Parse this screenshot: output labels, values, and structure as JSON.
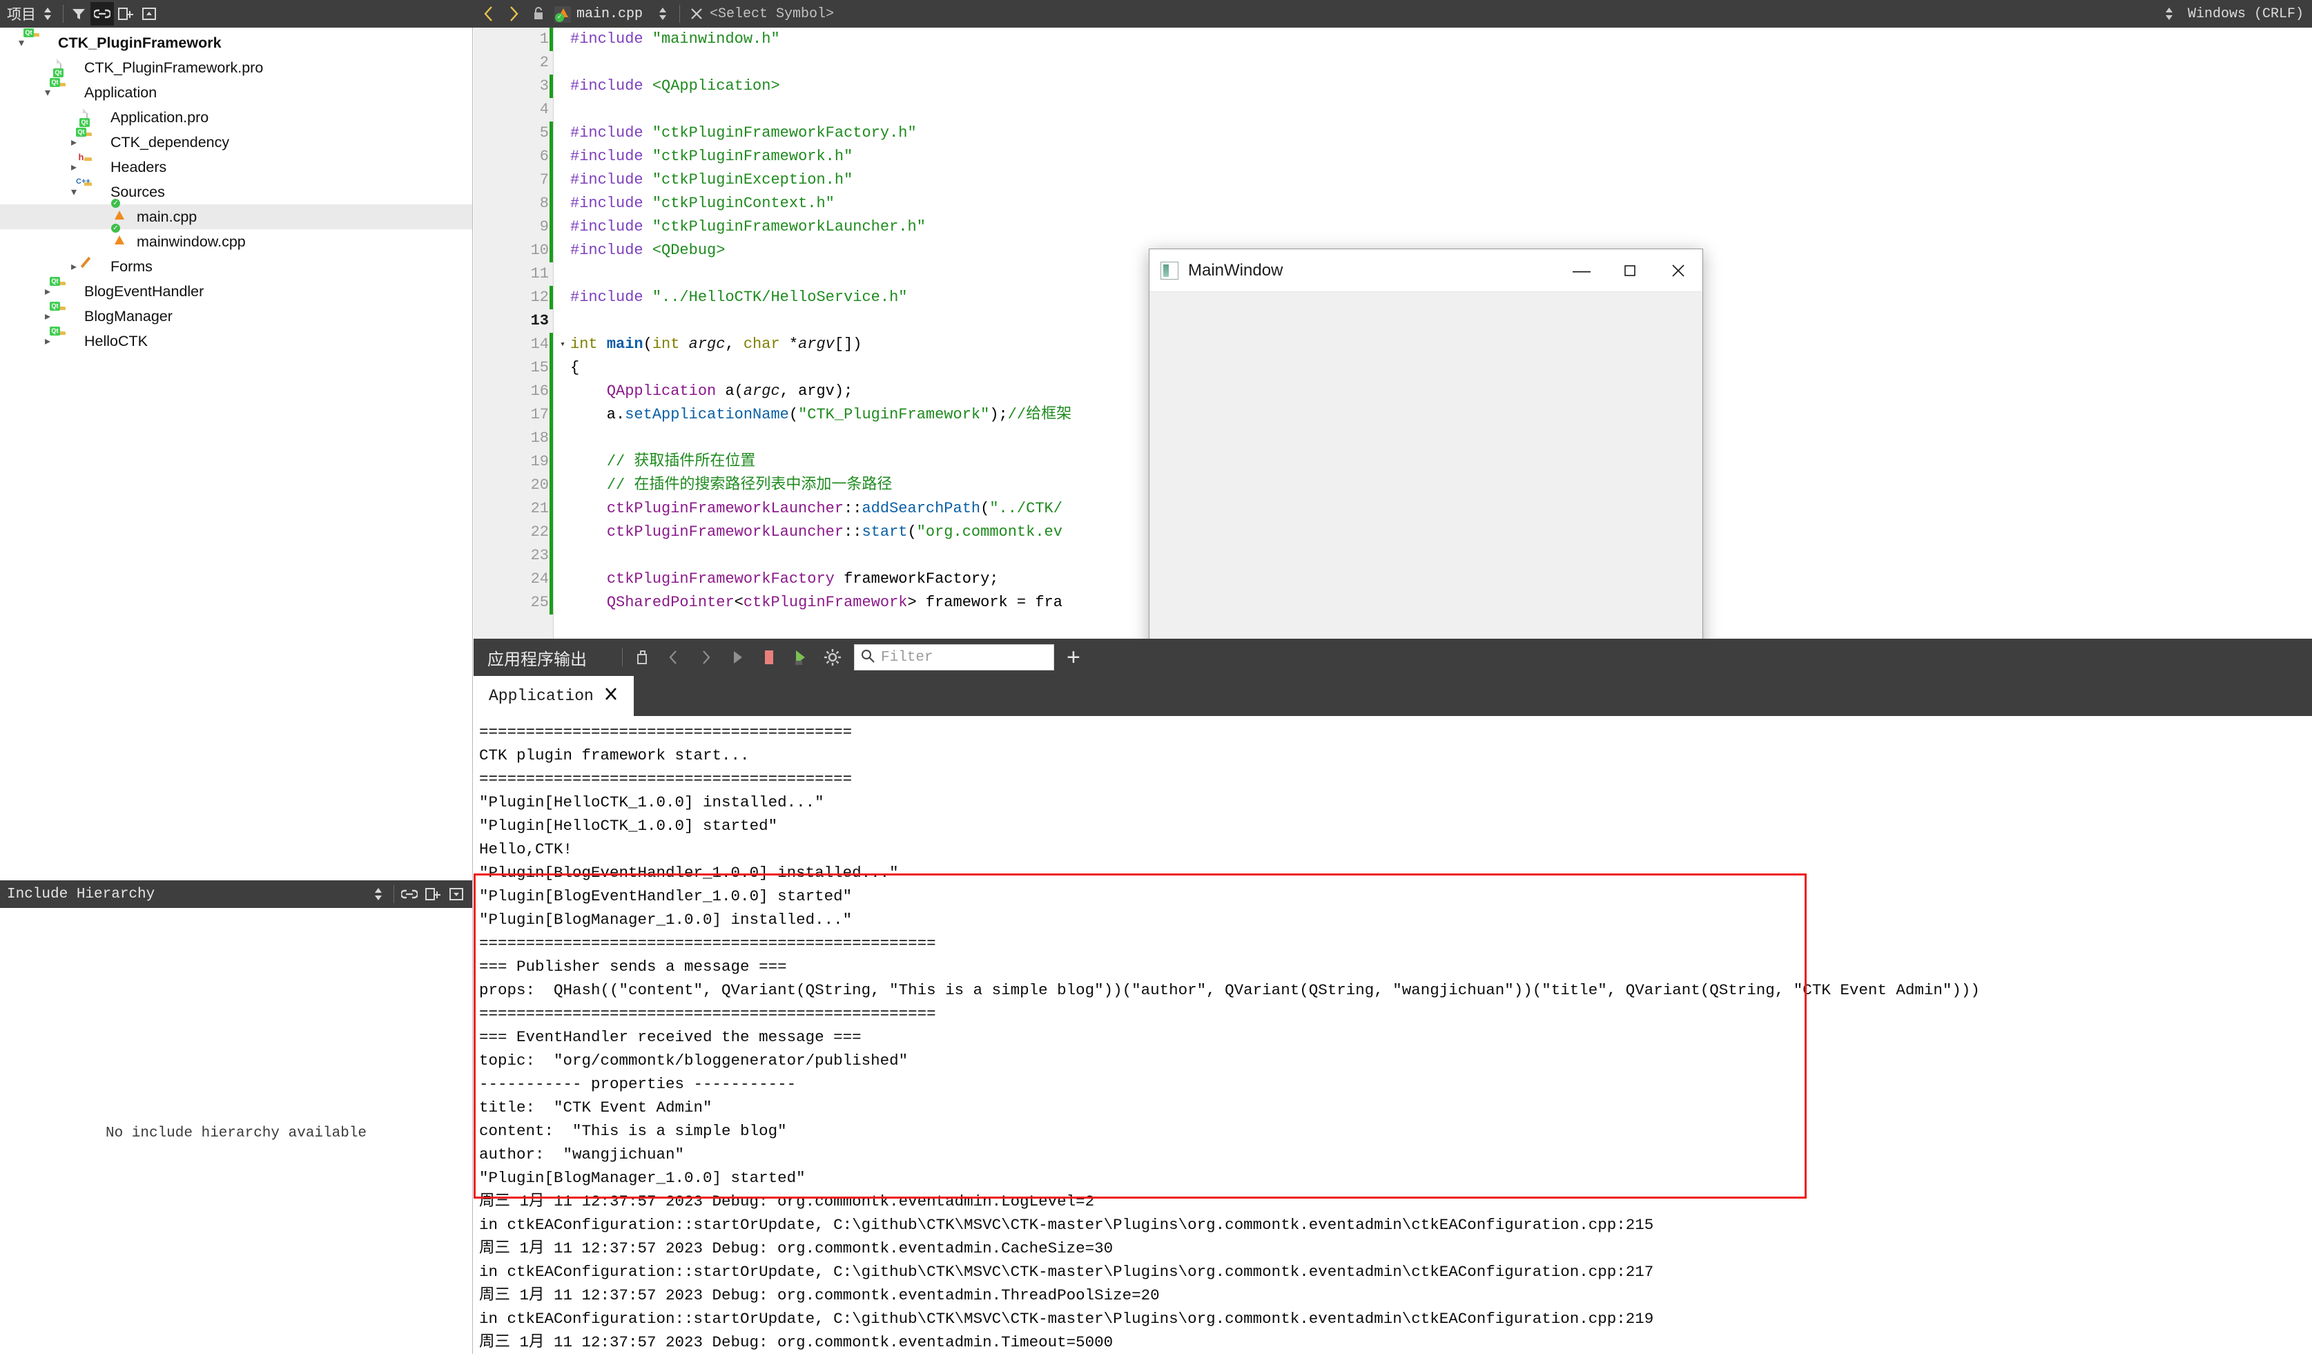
{
  "topbar": {
    "left_title": "项目",
    "left_icons": [
      "sort-icon",
      "filter-icon",
      "link-icon",
      "split-add-icon",
      "collapse-icon"
    ],
    "nav_back": "‹",
    "nav_forward": "›",
    "lock_icon": "lock-icon",
    "file_tab": "main.cpp",
    "symbol_placeholder": "<Select Symbol>",
    "right_meta": "Windows  (CRLF)"
  },
  "sidebar": {
    "items": [
      {
        "label": "CTK_PluginFramework",
        "indent": 0,
        "twist": "▾",
        "icon": "folder-qt",
        "bold": true,
        "selected": false
      },
      {
        "label": "CTK_PluginFramework.pro",
        "indent": 1,
        "twist": "",
        "icon": "doc-qt",
        "bold": false,
        "selected": false
      },
      {
        "label": "Application",
        "indent": 1,
        "twist": "▾",
        "icon": "folder-qt",
        "bold": false,
        "selected": false
      },
      {
        "label": "Application.pro",
        "indent": 2,
        "twist": "",
        "icon": "doc-qt",
        "bold": false,
        "selected": false
      },
      {
        "label": "CTK_dependency",
        "indent": 2,
        "twist": "▸",
        "icon": "folder-qt",
        "bold": false,
        "selected": false
      },
      {
        "label": "Headers",
        "indent": 2,
        "twist": "▸",
        "icon": "folder-h",
        "bold": false,
        "selected": false
      },
      {
        "label": "Sources",
        "indent": 2,
        "twist": "▾",
        "icon": "folder-cpp",
        "bold": false,
        "selected": false
      },
      {
        "label": "main.cpp",
        "indent": 3,
        "twist": "",
        "icon": "cpp-file",
        "bold": false,
        "selected": true
      },
      {
        "label": "mainwindow.cpp",
        "indent": 3,
        "twist": "",
        "icon": "cpp-file",
        "bold": false,
        "selected": false
      },
      {
        "label": "Forms",
        "indent": 2,
        "twist": "▸",
        "icon": "folder-form",
        "bold": false,
        "selected": false
      },
      {
        "label": "BlogEventHandler",
        "indent": 1,
        "twist": "▸",
        "icon": "folder-qt",
        "bold": false,
        "selected": false
      },
      {
        "label": "BlogManager",
        "indent": 1,
        "twist": "▸",
        "icon": "folder-qt",
        "bold": false,
        "selected": false
      },
      {
        "label": "HelloCTK",
        "indent": 1,
        "twist": "▸",
        "icon": "folder-qt",
        "bold": false,
        "selected": false
      }
    ]
  },
  "include_hierarchy": {
    "title": "Include Hierarchy",
    "empty_message": "No include hierarchy available",
    "icons": [
      "sort-icon",
      "link-icon",
      "split-add-icon",
      "collapse-icon"
    ]
  },
  "editor": {
    "first_line": 1,
    "current_line": 13,
    "lines": [
      {
        "n": 1,
        "changed": true,
        "fold": "",
        "html": "<span class='k-pre'>#include</span> <span class='k-str'>\"mainwindow.h\"</span>"
      },
      {
        "n": 2,
        "changed": false,
        "fold": "",
        "html": ""
      },
      {
        "n": 3,
        "changed": true,
        "fold": "",
        "html": "<span class='k-pre'>#include</span> <span class='k-str'>&lt;QApplication&gt;</span>"
      },
      {
        "n": 4,
        "changed": false,
        "fold": "",
        "html": ""
      },
      {
        "n": 5,
        "changed": true,
        "fold": "",
        "html": "<span class='k-pre'>#include</span> <span class='k-str'>\"ctkPluginFrameworkFactory.h\"</span>"
      },
      {
        "n": 6,
        "changed": true,
        "fold": "",
        "html": "<span class='k-pre'>#include</span> <span class='k-str'>\"ctkPluginFramework.h\"</span>"
      },
      {
        "n": 7,
        "changed": true,
        "fold": "",
        "html": "<span class='k-pre'>#include</span> <span class='k-str'>\"ctkPluginException.h\"</span>"
      },
      {
        "n": 8,
        "changed": true,
        "fold": "",
        "html": "<span class='k-pre'>#include</span> <span class='k-str'>\"ctkPluginContext.h\"</span>"
      },
      {
        "n": 9,
        "changed": true,
        "fold": "",
        "html": "<span class='k-pre'>#include</span> <span class='k-str'>\"ctkPluginFrameworkLauncher.h\"</span>"
      },
      {
        "n": 10,
        "changed": true,
        "fold": "",
        "html": "<span class='k-pre'>#include</span> <span class='k-str'>&lt;QDebug&gt;</span>"
      },
      {
        "n": 11,
        "changed": false,
        "fold": "",
        "html": ""
      },
      {
        "n": 12,
        "changed": true,
        "fold": "",
        "html": "<span class='k-pre'>#include</span> <span class='k-str'>\"../HelloCTK/HelloService.h\"</span>"
      },
      {
        "n": 13,
        "changed": false,
        "fold": "",
        "html": ""
      },
      {
        "n": 14,
        "changed": true,
        "fold": "▾",
        "html": "<span class='k-type'>int</span> <span class='k-fn'>main</span>(<span class='k-type'>int</span> <span class='k-param'>argc</span>, <span class='k-type'>char</span> *<span class='k-param'>argv</span>[])"
      },
      {
        "n": 15,
        "changed": true,
        "fold": "",
        "html": "{"
      },
      {
        "n": 16,
        "changed": true,
        "fold": "",
        "html": "    <span class='k-cls'>QApplication</span> a(<span class='k-param'>argc</span>, argv);"
      },
      {
        "n": 17,
        "changed": true,
        "fold": "",
        "html": "    a.<span class='k-meth'>setApplicationName</span>(<span class='k-str'>\"CTK_PluginFramework\"</span>);<span class='k-cmt'>//给框架</span>"
      },
      {
        "n": 18,
        "changed": true,
        "fold": "",
        "html": ""
      },
      {
        "n": 19,
        "changed": true,
        "fold": "",
        "html": "    <span class='k-cmt'>// 获取插件所在位置</span>"
      },
      {
        "n": 20,
        "changed": true,
        "fold": "",
        "html": "    <span class='k-cmt'>// 在插件的搜索路径列表中添加一条路径</span>"
      },
      {
        "n": 21,
        "changed": true,
        "fold": "",
        "html": "    <span class='k-cls'>ctkPluginFrameworkLauncher</span>::<span class='k-meth'>addSearchPath</span>(<span class='k-str'>\"../CTK/</span>"
      },
      {
        "n": 22,
        "changed": true,
        "fold": "",
        "html": "    <span class='k-cls'>ctkPluginFrameworkLauncher</span>::<span class='k-meth'>start</span>(<span class='k-str'>\"org.commontk.ev</span>"
      },
      {
        "n": 23,
        "changed": true,
        "fold": "",
        "html": ""
      },
      {
        "n": 24,
        "changed": true,
        "fold": "",
        "html": "    <span class='k-cls'>ctkPluginFrameworkFactory</span> frameworkFactory;"
      },
      {
        "n": 25,
        "changed": true,
        "fold": "",
        "html": "    <span class='k-cls'>QSharedPointer</span>&lt;<span class='k-cls'>ctkPluginFramework</span>&gt; framework = fra"
      }
    ]
  },
  "mainwindow_dialog": {
    "title": "MainWindow",
    "minimize_label": "—",
    "maximize_label": "▢",
    "close_label": "✕"
  },
  "output_pane": {
    "title": "应用程序输出",
    "buttons": [
      "copy-icon",
      "prev-icon",
      "next-icon",
      "run-icon",
      "stop-icon",
      "rerun-icon",
      "settings-icon"
    ],
    "filter_placeholder": "Filter",
    "add_label": "+",
    "tabs": [
      {
        "label": "Application",
        "close": "✕",
        "active": true
      }
    ]
  },
  "console": {
    "lines": [
      "========================================",
      "CTK plugin framework start...",
      "========================================",
      "\"Plugin[HelloCTK_1.0.0] installed...\"",
      "\"Plugin[HelloCTK_1.0.0] started\"",
      "Hello,CTK!",
      "\"Plugin[BlogEventHandler_1.0.0] installed...\"",
      "\"Plugin[BlogEventHandler_1.0.0] started\"",
      "\"Plugin[BlogManager_1.0.0] installed...\"",
      "=================================================",
      "=== Publisher sends a message ===",
      "props:  QHash((\"content\", QVariant(QString, \"This is a simple blog\"))(\"author\", QVariant(QString, \"wangjichuan\"))(\"title\", QVariant(QString, \"CTK Event Admin\")))",
      "=================================================",
      "=== EventHandler received the message ===",
      "topic:  \"org/commontk/bloggenerator/published\"",
      "----------- properties -----------",
      "title:  \"CTK Event Admin\"",
      "content:  \"This is a simple blog\"",
      "author:  \"wangjichuan\"",
      "\"Plugin[BlogManager_1.0.0] started\"",
      "周三 1月 11 12:37:57 2023 Debug: org.commontk.eventadmin.LogLevel=2",
      "in ctkEAConfiguration::startOrUpdate, C:\\github\\CTK\\MSVC\\CTK-master\\Plugins\\org.commontk.eventadmin\\ctkEAConfiguration.cpp:215",
      "周三 1月 11 12:37:57 2023 Debug: org.commontk.eventadmin.CacheSize=30",
      "in ctkEAConfiguration::startOrUpdate, C:\\github\\CTK\\MSVC\\CTK-master\\Plugins\\org.commontk.eventadmin\\ctkEAConfiguration.cpp:217",
      "周三 1月 11 12:37:57 2023 Debug: org.commontk.eventadmin.ThreadPoolSize=20",
      "in ctkEAConfiguration::startOrUpdate, C:\\github\\CTK\\MSVC\\CTK-master\\Plugins\\org.commontk.eventadmin\\ctkEAConfiguration.cpp:219",
      "周三 1月 11 12:37:57 2023 Debug: org.commontk.eventadmin.Timeout=5000"
    ],
    "highlight_color": "#ee1c1c",
    "highlight_start_line": 6,
    "highlight_end_line": 19
  }
}
